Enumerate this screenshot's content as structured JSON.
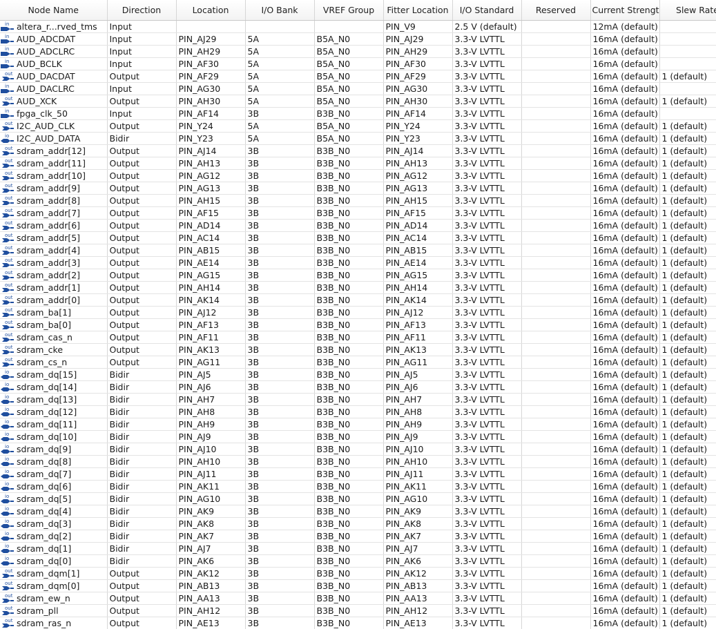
{
  "columns": [
    "Node Name",
    "Direction",
    "Location",
    "I/O Bank",
    "VREF Group",
    "Fitter Location",
    "I/O Standard",
    "Reserved",
    "Current Strength",
    "Slew Rate"
  ],
  "icon_colors": {
    "glyph": "#1f4e9e",
    "label": "#1f4e9e"
  },
  "icon_labels": {
    "in": "in",
    "out": "out",
    "io": "io"
  },
  "rows": [
    {
      "icon": "in",
      "name": "altera_r...rved_tms",
      "direction": "Input",
      "location": "",
      "bank": "",
      "vref": "",
      "fitter": "PIN_V9",
      "standard": "2.5 V (default)",
      "reserved": "",
      "current": "12mA (default)",
      "slew": ""
    },
    {
      "icon": "in",
      "name": "AUD_ADCDAT",
      "direction": "Input",
      "location": "PIN_AJ29",
      "bank": "5A",
      "vref": "B5A_N0",
      "fitter": "PIN_AJ29",
      "standard": "3.3-V LVTTL",
      "reserved": "",
      "current": "16mA (default)",
      "slew": ""
    },
    {
      "icon": "in",
      "name": "AUD_ADCLRC",
      "direction": "Input",
      "location": "PIN_AH29",
      "bank": "5A",
      "vref": "B5A_N0",
      "fitter": "PIN_AH29",
      "standard": "3.3-V LVTTL",
      "reserved": "",
      "current": "16mA (default)",
      "slew": ""
    },
    {
      "icon": "in",
      "name": "AUD_BCLK",
      "direction": "Input",
      "location": "PIN_AF30",
      "bank": "5A",
      "vref": "B5A_N0",
      "fitter": "PIN_AF30",
      "standard": "3.3-V LVTTL",
      "reserved": "",
      "current": "16mA (default)",
      "slew": ""
    },
    {
      "icon": "out",
      "name": "AUD_DACDAT",
      "direction": "Output",
      "location": "PIN_AF29",
      "bank": "5A",
      "vref": "B5A_N0",
      "fitter": "PIN_AF29",
      "standard": "3.3-V LVTTL",
      "reserved": "",
      "current": "16mA (default)",
      "slew": "1 (default)"
    },
    {
      "icon": "in",
      "name": "AUD_DACLRC",
      "direction": "Input",
      "location": "PIN_AG30",
      "bank": "5A",
      "vref": "B5A_N0",
      "fitter": "PIN_AG30",
      "standard": "3.3-V LVTTL",
      "reserved": "",
      "current": "16mA (default)",
      "slew": ""
    },
    {
      "icon": "out",
      "name": "AUD_XCK",
      "direction": "Output",
      "location": "PIN_AH30",
      "bank": "5A",
      "vref": "B5A_N0",
      "fitter": "PIN_AH30",
      "standard": "3.3-V LVTTL",
      "reserved": "",
      "current": "16mA (default)",
      "slew": "1 (default)"
    },
    {
      "icon": "in",
      "name": "fpga_clk_50",
      "direction": "Input",
      "location": "PIN_AF14",
      "bank": "3B",
      "vref": "B3B_N0",
      "fitter": "PIN_AF14",
      "standard": "3.3-V LVTTL",
      "reserved": "",
      "current": "16mA (default)",
      "slew": ""
    },
    {
      "icon": "out",
      "name": "I2C_AUD_CLK",
      "direction": "Output",
      "location": "PIN_Y24",
      "bank": "5A",
      "vref": "B5A_N0",
      "fitter": "PIN_Y24",
      "standard": "3.3-V LVTTL",
      "reserved": "",
      "current": "16mA (default)",
      "slew": "1 (default)"
    },
    {
      "icon": "io",
      "name": "I2C_AUD_DATA",
      "direction": "Bidir",
      "location": "PIN_Y23",
      "bank": "5A",
      "vref": "B5A_N0",
      "fitter": "PIN_Y23",
      "standard": "3.3-V LVTTL",
      "reserved": "",
      "current": "16mA (default)",
      "slew": "1 (default)"
    },
    {
      "icon": "out",
      "name": "sdram_addr[12]",
      "direction": "Output",
      "location": "PIN_AJ14",
      "bank": "3B",
      "vref": "B3B_N0",
      "fitter": "PIN_AJ14",
      "standard": "3.3-V LVTTL",
      "reserved": "",
      "current": "16mA (default)",
      "slew": "1 (default)"
    },
    {
      "icon": "out",
      "name": "sdram_addr[11]",
      "direction": "Output",
      "location": "PIN_AH13",
      "bank": "3B",
      "vref": "B3B_N0",
      "fitter": "PIN_AH13",
      "standard": "3.3-V LVTTL",
      "reserved": "",
      "current": "16mA (default)",
      "slew": "1 (default)"
    },
    {
      "icon": "out",
      "name": "sdram_addr[10]",
      "direction": "Output",
      "location": "PIN_AG12",
      "bank": "3B",
      "vref": "B3B_N0",
      "fitter": "PIN_AG12",
      "standard": "3.3-V LVTTL",
      "reserved": "",
      "current": "16mA (default)",
      "slew": "1 (default)"
    },
    {
      "icon": "out",
      "name": "sdram_addr[9]",
      "direction": "Output",
      "location": "PIN_AG13",
      "bank": "3B",
      "vref": "B3B_N0",
      "fitter": "PIN_AG13",
      "standard": "3.3-V LVTTL",
      "reserved": "",
      "current": "16mA (default)",
      "slew": "1 (default)"
    },
    {
      "icon": "out",
      "name": "sdram_addr[8]",
      "direction": "Output",
      "location": "PIN_AH15",
      "bank": "3B",
      "vref": "B3B_N0",
      "fitter": "PIN_AH15",
      "standard": "3.3-V LVTTL",
      "reserved": "",
      "current": "16mA (default)",
      "slew": "1 (default)"
    },
    {
      "icon": "out",
      "name": "sdram_addr[7]",
      "direction": "Output",
      "location": "PIN_AF15",
      "bank": "3B",
      "vref": "B3B_N0",
      "fitter": "PIN_AF15",
      "standard": "3.3-V LVTTL",
      "reserved": "",
      "current": "16mA (default)",
      "slew": "1 (default)"
    },
    {
      "icon": "out",
      "name": "sdram_addr[6]",
      "direction": "Output",
      "location": "PIN_AD14",
      "bank": "3B",
      "vref": "B3B_N0",
      "fitter": "PIN_AD14",
      "standard": "3.3-V LVTTL",
      "reserved": "",
      "current": "16mA (default)",
      "slew": "1 (default)"
    },
    {
      "icon": "out",
      "name": "sdram_addr[5]",
      "direction": "Output",
      "location": "PIN_AC14",
      "bank": "3B",
      "vref": "B3B_N0",
      "fitter": "PIN_AC14",
      "standard": "3.3-V LVTTL",
      "reserved": "",
      "current": "16mA (default)",
      "slew": "1 (default)"
    },
    {
      "icon": "out",
      "name": "sdram_addr[4]",
      "direction": "Output",
      "location": "PIN_AB15",
      "bank": "3B",
      "vref": "B3B_N0",
      "fitter": "PIN_AB15",
      "standard": "3.3-V LVTTL",
      "reserved": "",
      "current": "16mA (default)",
      "slew": "1 (default)"
    },
    {
      "icon": "out",
      "name": "sdram_addr[3]",
      "direction": "Output",
      "location": "PIN_AE14",
      "bank": "3B",
      "vref": "B3B_N0",
      "fitter": "PIN_AE14",
      "standard": "3.3-V LVTTL",
      "reserved": "",
      "current": "16mA (default)",
      "slew": "1 (default)"
    },
    {
      "icon": "out",
      "name": "sdram_addr[2]",
      "direction": "Output",
      "location": "PIN_AG15",
      "bank": "3B",
      "vref": "B3B_N0",
      "fitter": "PIN_AG15",
      "standard": "3.3-V LVTTL",
      "reserved": "",
      "current": "16mA (default)",
      "slew": "1 (default)"
    },
    {
      "icon": "out",
      "name": "sdram_addr[1]",
      "direction": "Output",
      "location": "PIN_AH14",
      "bank": "3B",
      "vref": "B3B_N0",
      "fitter": "PIN_AH14",
      "standard": "3.3-V LVTTL",
      "reserved": "",
      "current": "16mA (default)",
      "slew": "1 (default)"
    },
    {
      "icon": "out",
      "name": "sdram_addr[0]",
      "direction": "Output",
      "location": "PIN_AK14",
      "bank": "3B",
      "vref": "B3B_N0",
      "fitter": "PIN_AK14",
      "standard": "3.3-V LVTTL",
      "reserved": "",
      "current": "16mA (default)",
      "slew": "1 (default)"
    },
    {
      "icon": "out",
      "name": "sdram_ba[1]",
      "direction": "Output",
      "location": "PIN_AJ12",
      "bank": "3B",
      "vref": "B3B_N0",
      "fitter": "PIN_AJ12",
      "standard": "3.3-V LVTTL",
      "reserved": "",
      "current": "16mA (default)",
      "slew": "1 (default)"
    },
    {
      "icon": "out",
      "name": "sdram_ba[0]",
      "direction": "Output",
      "location": "PIN_AF13",
      "bank": "3B",
      "vref": "B3B_N0",
      "fitter": "PIN_AF13",
      "standard": "3.3-V LVTTL",
      "reserved": "",
      "current": "16mA (default)",
      "slew": "1 (default)"
    },
    {
      "icon": "out",
      "name": "sdram_cas_n",
      "direction": "Output",
      "location": "PIN_AF11",
      "bank": "3B",
      "vref": "B3B_N0",
      "fitter": "PIN_AF11",
      "standard": "3.3-V LVTTL",
      "reserved": "",
      "current": "16mA (default)",
      "slew": "1 (default)"
    },
    {
      "icon": "out",
      "name": "sdram_cke",
      "direction": "Output",
      "location": "PIN_AK13",
      "bank": "3B",
      "vref": "B3B_N0",
      "fitter": "PIN_AK13",
      "standard": "3.3-V LVTTL",
      "reserved": "",
      "current": "16mA (default)",
      "slew": "1 (default)"
    },
    {
      "icon": "out",
      "name": "sdram_cs_n",
      "direction": "Output",
      "location": "PIN_AG11",
      "bank": "3B",
      "vref": "B3B_N0",
      "fitter": "PIN_AG11",
      "standard": "3.3-V LVTTL",
      "reserved": "",
      "current": "16mA (default)",
      "slew": "1 (default)"
    },
    {
      "icon": "io",
      "name": "sdram_dq[15]",
      "direction": "Bidir",
      "location": "PIN_AJ5",
      "bank": "3B",
      "vref": "B3B_N0",
      "fitter": "PIN_AJ5",
      "standard": "3.3-V LVTTL",
      "reserved": "",
      "current": "16mA (default)",
      "slew": "1 (default)"
    },
    {
      "icon": "io",
      "name": "sdram_dq[14]",
      "direction": "Bidir",
      "location": "PIN_AJ6",
      "bank": "3B",
      "vref": "B3B_N0",
      "fitter": "PIN_AJ6",
      "standard": "3.3-V LVTTL",
      "reserved": "",
      "current": "16mA (default)",
      "slew": "1 (default)"
    },
    {
      "icon": "io",
      "name": "sdram_dq[13]",
      "direction": "Bidir",
      "location": "PIN_AH7",
      "bank": "3B",
      "vref": "B3B_N0",
      "fitter": "PIN_AH7",
      "standard": "3.3-V LVTTL",
      "reserved": "",
      "current": "16mA (default)",
      "slew": "1 (default)"
    },
    {
      "icon": "io",
      "name": "sdram_dq[12]",
      "direction": "Bidir",
      "location": "PIN_AH8",
      "bank": "3B",
      "vref": "B3B_N0",
      "fitter": "PIN_AH8",
      "standard": "3.3-V LVTTL",
      "reserved": "",
      "current": "16mA (default)",
      "slew": "1 (default)"
    },
    {
      "icon": "io",
      "name": "sdram_dq[11]",
      "direction": "Bidir",
      "location": "PIN_AH9",
      "bank": "3B",
      "vref": "B3B_N0",
      "fitter": "PIN_AH9",
      "standard": "3.3-V LVTTL",
      "reserved": "",
      "current": "16mA (default)",
      "slew": "1 (default)"
    },
    {
      "icon": "io",
      "name": "sdram_dq[10]",
      "direction": "Bidir",
      "location": "PIN_AJ9",
      "bank": "3B",
      "vref": "B3B_N0",
      "fitter": "PIN_AJ9",
      "standard": "3.3-V LVTTL",
      "reserved": "",
      "current": "16mA (default)",
      "slew": "1 (default)"
    },
    {
      "icon": "io",
      "name": "sdram_dq[9]",
      "direction": "Bidir",
      "location": "PIN_AJ10",
      "bank": "3B",
      "vref": "B3B_N0",
      "fitter": "PIN_AJ10",
      "standard": "3.3-V LVTTL",
      "reserved": "",
      "current": "16mA (default)",
      "slew": "1 (default)"
    },
    {
      "icon": "io",
      "name": "sdram_dq[8]",
      "direction": "Bidir",
      "location": "PIN_AH10",
      "bank": "3B",
      "vref": "B3B_N0",
      "fitter": "PIN_AH10",
      "standard": "3.3-V LVTTL",
      "reserved": "",
      "current": "16mA (default)",
      "slew": "1 (default)"
    },
    {
      "icon": "io",
      "name": "sdram_dq[7]",
      "direction": "Bidir",
      "location": "PIN_AJ11",
      "bank": "3B",
      "vref": "B3B_N0",
      "fitter": "PIN_AJ11",
      "standard": "3.3-V LVTTL",
      "reserved": "",
      "current": "16mA (default)",
      "slew": "1 (default)"
    },
    {
      "icon": "io",
      "name": "sdram_dq[6]",
      "direction": "Bidir",
      "location": "PIN_AK11",
      "bank": "3B",
      "vref": "B3B_N0",
      "fitter": "PIN_AK11",
      "standard": "3.3-V LVTTL",
      "reserved": "",
      "current": "16mA (default)",
      "slew": "1 (default)"
    },
    {
      "icon": "io",
      "name": "sdram_dq[5]",
      "direction": "Bidir",
      "location": "PIN_AG10",
      "bank": "3B",
      "vref": "B3B_N0",
      "fitter": "PIN_AG10",
      "standard": "3.3-V LVTTL",
      "reserved": "",
      "current": "16mA (default)",
      "slew": "1 (default)"
    },
    {
      "icon": "io",
      "name": "sdram_dq[4]",
      "direction": "Bidir",
      "location": "PIN_AK9",
      "bank": "3B",
      "vref": "B3B_N0",
      "fitter": "PIN_AK9",
      "standard": "3.3-V LVTTL",
      "reserved": "",
      "current": "16mA (default)",
      "slew": "1 (default)"
    },
    {
      "icon": "io",
      "name": "sdram_dq[3]",
      "direction": "Bidir",
      "location": "PIN_AK8",
      "bank": "3B",
      "vref": "B3B_N0",
      "fitter": "PIN_AK8",
      "standard": "3.3-V LVTTL",
      "reserved": "",
      "current": "16mA (default)",
      "slew": "1 (default)"
    },
    {
      "icon": "io",
      "name": "sdram_dq[2]",
      "direction": "Bidir",
      "location": "PIN_AK7",
      "bank": "3B",
      "vref": "B3B_N0",
      "fitter": "PIN_AK7",
      "standard": "3.3-V LVTTL",
      "reserved": "",
      "current": "16mA (default)",
      "slew": "1 (default)"
    },
    {
      "icon": "io",
      "name": "sdram_dq[1]",
      "direction": "Bidir",
      "location": "PIN_AJ7",
      "bank": "3B",
      "vref": "B3B_N0",
      "fitter": "PIN_AJ7",
      "standard": "3.3-V LVTTL",
      "reserved": "",
      "current": "16mA (default)",
      "slew": "1 (default)"
    },
    {
      "icon": "io",
      "name": "sdram_dq[0]",
      "direction": "Bidir",
      "location": "PIN_AK6",
      "bank": "3B",
      "vref": "B3B_N0",
      "fitter": "PIN_AK6",
      "standard": "3.3-V LVTTL",
      "reserved": "",
      "current": "16mA (default)",
      "slew": "1 (default)"
    },
    {
      "icon": "out",
      "name": "sdram_dqm[1]",
      "direction": "Output",
      "location": "PIN_AK12",
      "bank": "3B",
      "vref": "B3B_N0",
      "fitter": "PIN_AK12",
      "standard": "3.3-V LVTTL",
      "reserved": "",
      "current": "16mA (default)",
      "slew": "1 (default)"
    },
    {
      "icon": "out",
      "name": "sdram_dqm[0]",
      "direction": "Output",
      "location": "PIN_AB13",
      "bank": "3B",
      "vref": "B3B_N0",
      "fitter": "PIN_AB13",
      "standard": "3.3-V LVTTL",
      "reserved": "",
      "current": "16mA (default)",
      "slew": "1 (default)"
    },
    {
      "icon": "out",
      "name": "sdram_ew_n",
      "direction": "Output",
      "location": "PIN_AA13",
      "bank": "3B",
      "vref": "B3B_N0",
      "fitter": "PIN_AA13",
      "standard": "3.3-V LVTTL",
      "reserved": "",
      "current": "16mA (default)",
      "slew": "1 (default)"
    },
    {
      "icon": "out",
      "name": "sdram_pll",
      "direction": "Output",
      "location": "PIN_AH12",
      "bank": "3B",
      "vref": "B3B_N0",
      "fitter": "PIN_AH12",
      "standard": "3.3-V LVTTL",
      "reserved": "",
      "current": "16mA (default)",
      "slew": "1 (default)"
    },
    {
      "icon": "out",
      "name": "sdram_ras_n",
      "direction": "Output",
      "location": "PIN_AE13",
      "bank": "3B",
      "vref": "B3B_N0",
      "fitter": "PIN_AE13",
      "standard": "3.3-V LVTTL",
      "reserved": "",
      "current": "16mA (default)",
      "slew": "1 (default)"
    }
  ]
}
